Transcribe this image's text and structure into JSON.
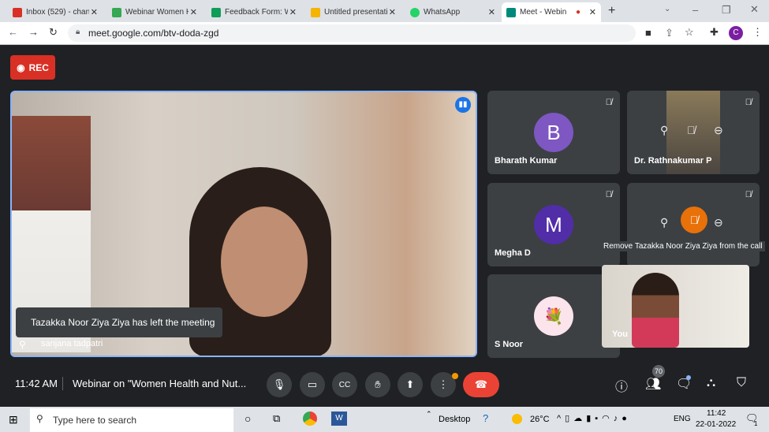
{
  "browser": {
    "tabs": [
      {
        "label": "Inbox (529) - chan",
        "icon": "gmail-icon",
        "color": "#d93025"
      },
      {
        "label": "Webinar Women H",
        "icon": "drive-icon",
        "color": "#34a853"
      },
      {
        "label": "Feedback Form: W",
        "icon": "forms-sheets-icon",
        "color": "#0f9d58"
      },
      {
        "label": "Untitled presentati",
        "icon": "slides-icon",
        "color": "#f4b400"
      },
      {
        "label": "WhatsApp",
        "icon": "whatsapp-icon",
        "color": "#25d366"
      },
      {
        "label": "Meet - Webin",
        "icon": "meet-icon",
        "color": "#00897b",
        "active": true
      }
    ],
    "url": "meet.google.com/btv-doda-zgd",
    "profile": "C"
  },
  "meet": {
    "rec_label": "REC",
    "main": {
      "name": "sanjana tadpatri",
      "toast": "Tazakka Noor Ziya Ziya has left the meeting"
    },
    "tiles": [
      {
        "name": "Bharath Kumar",
        "initial": "B",
        "color": "#7e57c2"
      },
      {
        "name": "Dr. Rathnakumar P"
      },
      {
        "name": "Megha D",
        "initial": "M",
        "color": "#512da8"
      },
      {
        "name": "S Noor"
      }
    ],
    "tooltip": "Remove Tazakka Noor Ziya Ziya from the call",
    "self_label": "You",
    "time": "11:42 AM",
    "title": "Webinar on \"Women Health and Nut...",
    "participants": "70",
    "accent": "#8ab4f8",
    "end_color": "#ea4335"
  },
  "taskbar": {
    "search_placeholder": "Type here to search",
    "desktop": "Desktop",
    "weather": "26°C",
    "lang": "ENG",
    "time": "11:42",
    "date": "22-01-2022",
    "notif": "1"
  }
}
